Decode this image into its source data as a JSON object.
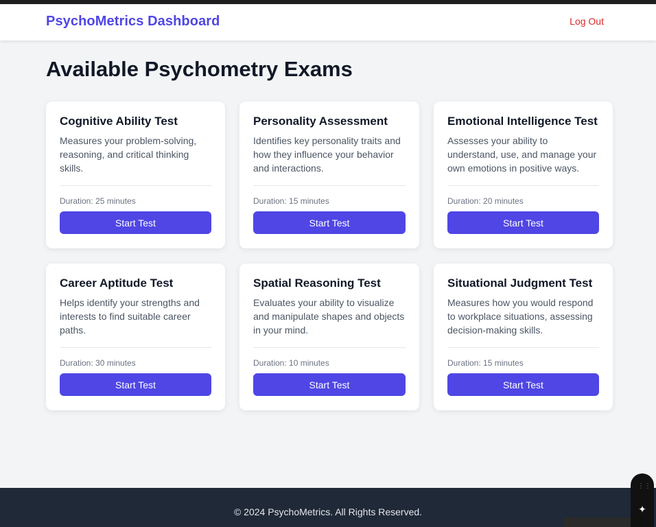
{
  "header": {
    "brand": "PsychoMetrics Dashboard",
    "logout_label": "Log Out"
  },
  "main": {
    "title": "Available Psychometry Exams",
    "exams": [
      {
        "title": "Cognitive Ability Test",
        "description": "Measures your problem-solving, reasoning, and critical thinking skills.",
        "duration": "Duration: 25 minutes",
        "button_label": "Start Test"
      },
      {
        "title": "Personality Assessment",
        "description": "Identifies key personality traits and how they influence your behavior and interactions.",
        "duration": "Duration: 15 minutes",
        "button_label": "Start Test"
      },
      {
        "title": "Emotional Intelligence Test",
        "description": "Assesses your ability to understand, use, and manage your own emotions in positive ways.",
        "duration": "Duration: 20 minutes",
        "button_label": "Start Test"
      },
      {
        "title": "Career Aptitude Test",
        "description": "Helps identify your strengths and interests to find suitable career paths.",
        "duration": "Duration: 30 minutes",
        "button_label": "Start Test"
      },
      {
        "title": "Spatial Reasoning Test",
        "description": "Evaluates your ability to visualize and manipulate shapes and objects in your mind.",
        "duration": "Duration: 10 minutes",
        "button_label": "Start Test"
      },
      {
        "title": "Situational Judgment Test",
        "description": "Measures how you would respond to workplace situations, assessing decision-making skills.",
        "duration": "Duration: 15 minutes",
        "button_label": "Start Test"
      }
    ]
  },
  "footer": {
    "copyright": "© 2024 PsychoMetrics. All Rights Reserved."
  },
  "icons": {
    "drag_handle": "drag-handle-icon",
    "sparkle": "sparkle-icon"
  },
  "colors": {
    "accent": "#4f46e5",
    "logout": "#dc2626",
    "footer_bg": "#1f2937",
    "page_bg": "#f3f4f6"
  }
}
